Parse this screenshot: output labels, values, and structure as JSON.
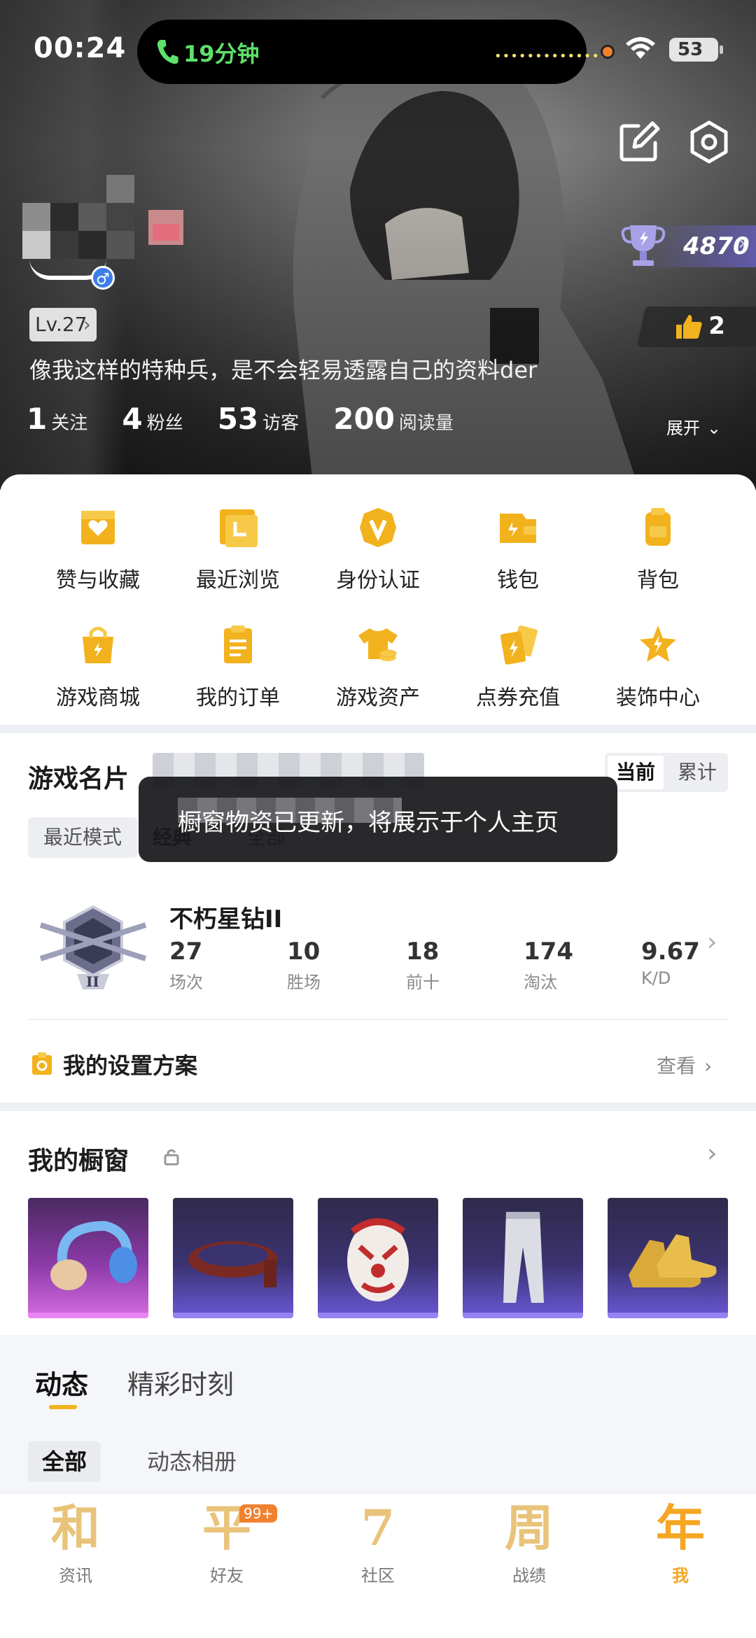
{
  "status_bar": {
    "time": "00:24",
    "call_duration": "19分钟",
    "battery": "53"
  },
  "profile": {
    "level": "Lv.27",
    "bio": "像我这样的特种兵，是不会轻易透露自己的资料der",
    "trophy_score": "4870",
    "likes": "2",
    "stats": [
      {
        "num": "1",
        "label": "关注"
      },
      {
        "num": "4",
        "label": "粉丝"
      },
      {
        "num": "53",
        "label": "访客"
      },
      {
        "num": "200",
        "label": "阅读量"
      }
    ],
    "expand_label": "展开"
  },
  "shortcuts": [
    {
      "label": "赞与收藏",
      "icon": "heart-bookmark-icon"
    },
    {
      "label": "最近浏览",
      "icon": "recent-browse-icon"
    },
    {
      "label": "身份认证",
      "icon": "verify-badge-icon"
    },
    {
      "label": "钱包",
      "icon": "wallet-icon"
    },
    {
      "label": "背包",
      "icon": "backpack-icon"
    },
    {
      "label": "游戏商城",
      "icon": "shop-bag-icon"
    },
    {
      "label": "我的订单",
      "icon": "order-list-icon"
    },
    {
      "label": "游戏资产",
      "icon": "shirt-coins-icon"
    },
    {
      "label": "点券充值",
      "icon": "voucher-cards-icon"
    },
    {
      "label": "装饰中心",
      "icon": "star-decor-icon"
    }
  ],
  "game_card": {
    "title": "游戏名片",
    "toggle": {
      "current": "当前",
      "total": "累计"
    },
    "modes": [
      "最近模式",
      "经典",
      "全部"
    ],
    "toast": "橱窗物资已更新，将展示于个人主页",
    "rank_name": "不朽星钻II",
    "rank_stats": [
      {
        "value": "27",
        "label": "场次"
      },
      {
        "value": "10",
        "label": "胜场"
      },
      {
        "value": "18",
        "label": "前十"
      },
      {
        "value": "174",
        "label": "淘汰"
      },
      {
        "value": "9.67",
        "label": "K/D"
      }
    ],
    "settings_title": "我的设置方案",
    "view_label": "查看"
  },
  "showcase": {
    "title": "我的橱窗"
  },
  "feed": {
    "tabs": [
      "动态",
      "精彩时刻"
    ],
    "subtabs": [
      "全部",
      "动态相册"
    ]
  },
  "bottom_nav": [
    {
      "glyph": "和",
      "label": "资讯"
    },
    {
      "glyph": "平",
      "label": "好友",
      "badge": "99+"
    },
    {
      "glyph": "7",
      "label": "社区"
    },
    {
      "glyph": "周",
      "label": "战绩"
    },
    {
      "glyph": "年",
      "label": "我"
    }
  ],
  "colors": {
    "accent": "#f5a623",
    "icon_yellow": "#f2b21d",
    "call_green": "#5ee06a"
  }
}
